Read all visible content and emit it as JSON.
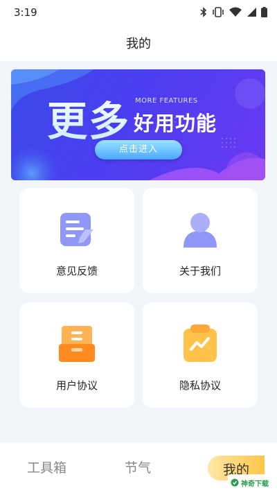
{
  "status_bar": {
    "time": "3:19",
    "icons": [
      "bluetooth-icon",
      "vibrate-icon",
      "wifi-icon",
      "signal-icon",
      "battery-icon"
    ]
  },
  "header": {
    "title": "我的"
  },
  "banner": {
    "big_text": "更多",
    "english_text": "MORE FEATURES",
    "sub_text": "好用功能",
    "button_label": "点击进入"
  },
  "cards": [
    {
      "label": "意见反馈",
      "icon": "feedback-note-icon",
      "color": "#8f97f7"
    },
    {
      "label": "关于我们",
      "icon": "user-profile-icon",
      "color": "#8f97f7"
    },
    {
      "label": "用户协议",
      "icon": "archive-box-icon",
      "color": "#ff8a1f"
    },
    {
      "label": "隐私协议",
      "icon": "clipboard-chart-icon",
      "color": "#ffc24a"
    }
  ],
  "tab_bar": {
    "tabs": [
      {
        "label": "工具箱"
      },
      {
        "label": "节气"
      },
      {
        "label": "我的",
        "active": true
      }
    ],
    "active_color": "#ffc64a"
  },
  "watermark": {
    "text": "神奇下载"
  }
}
